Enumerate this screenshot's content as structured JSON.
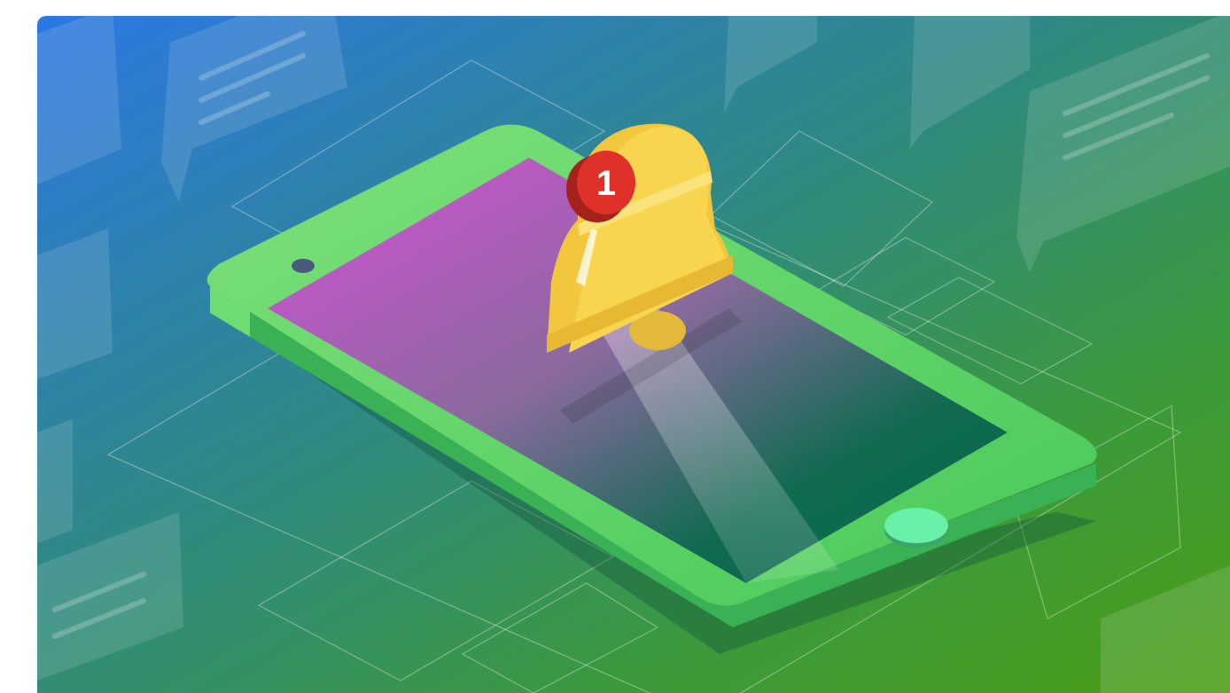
{
  "illustration": {
    "subject": "notification-bell-over-smartphone",
    "badge": {
      "count": "1",
      "color": "#e0302a"
    },
    "colors": {
      "background_start": "#2f7fe0",
      "background_end": "#4f9f1e",
      "phone_body": "#58d26a",
      "screen_start": "#d454d6",
      "screen_end": "#0e6a4e",
      "bell": "#f7d24a",
      "home_button": "#6af0a8"
    }
  }
}
